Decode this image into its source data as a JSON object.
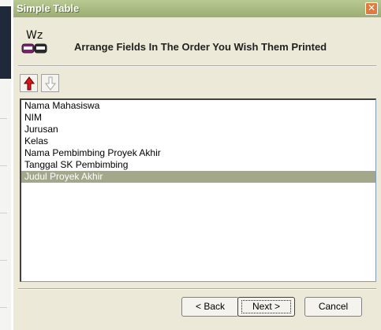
{
  "window": {
    "title": "Simple Table"
  },
  "header": {
    "logo_text": "Wz",
    "instruction": "Arrange Fields In The Order You Wish Them Printed"
  },
  "toolbar": {
    "move_up_icon": "red-up-arrow-icon",
    "move_down_icon": "gray-down-arrow-icon"
  },
  "fields": [
    "Nama Mahasiswa",
    "NIM",
    "Jurusan",
    "Kelas",
    "Nama Pembimbing Proyek Akhir",
    "Tanggal SK Pembimbing",
    "Judul Proyek Akhir"
  ],
  "selected_index": 6,
  "buttons": {
    "back": "< Back",
    "next": "Next >",
    "cancel": "Cancel"
  },
  "colors": {
    "titlebar": "#a4b77d",
    "selection": "#a4a88a",
    "dialog": "#ece9d8"
  }
}
